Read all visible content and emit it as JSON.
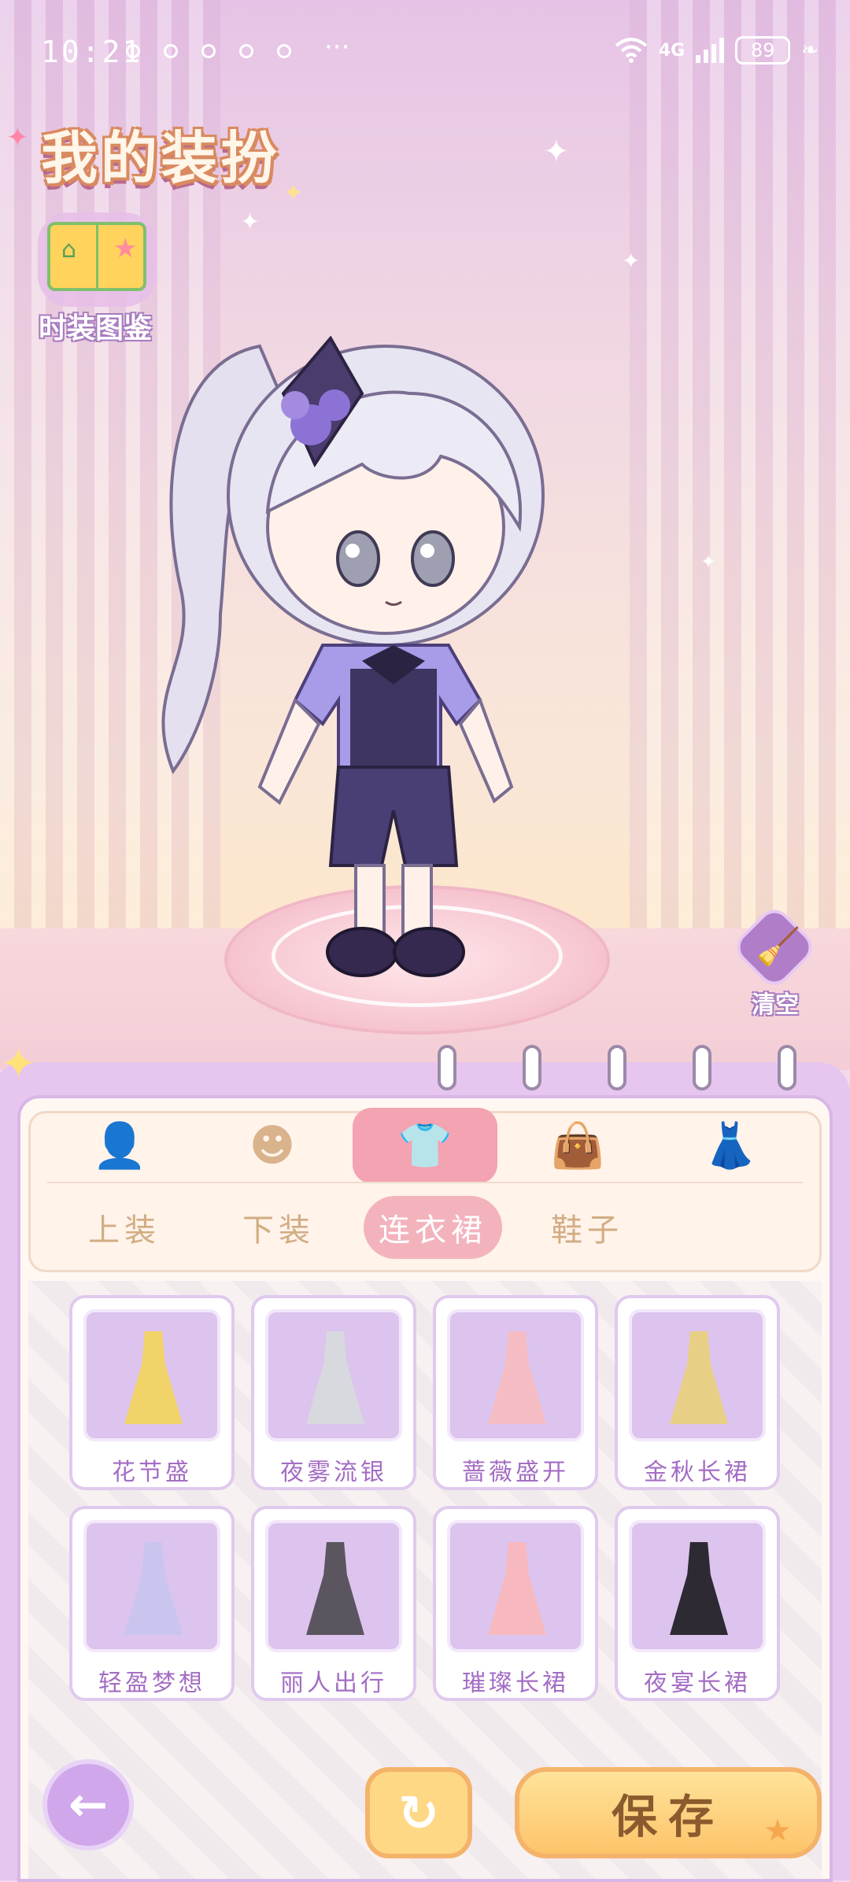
{
  "status_bar": {
    "time": "10:21",
    "more": "···",
    "network": "4G",
    "battery": "89"
  },
  "header": {
    "title": "我的装扮"
  },
  "fashion_book": {
    "label": "时装图鉴"
  },
  "clear_button": {
    "label": "清空"
  },
  "main_tabs": [
    {
      "icon": "hairstyle-icon",
      "active": false
    },
    {
      "icon": "face-icon",
      "active": false
    },
    {
      "icon": "clothing-icon",
      "active": true
    },
    {
      "icon": "bag-icon",
      "active": false
    },
    {
      "icon": "dress-stand-icon",
      "active": false
    }
  ],
  "sub_tabs": [
    {
      "label": "上装",
      "active": false
    },
    {
      "label": "下装",
      "active": false
    },
    {
      "label": "连衣裙",
      "active": true
    },
    {
      "label": "鞋子",
      "active": false
    }
  ],
  "items": [
    {
      "label": "花节盛",
      "color": "#f2d36a"
    },
    {
      "label": "夜雾流银",
      "color": "#d8d8df"
    },
    {
      "label": "蔷薇盛开",
      "color": "#f6bcc4"
    },
    {
      "label": "金秋长裙",
      "color": "#e8cf86"
    },
    {
      "label": "轻盈梦想",
      "color": "#c9c5ee"
    },
    {
      "label": "丽人出行",
      "color": "#5b5560"
    },
    {
      "label": "璀璨长裙",
      "color": "#f7b9bf"
    },
    {
      "label": "夜宴长裙",
      "color": "#2d2a33"
    }
  ],
  "buttons": {
    "back_icon": "back-arrow-icon",
    "refresh_icon": "refresh-icon",
    "save_label": "保存"
  },
  "colors": {
    "accent_pink": "#f3a3b2",
    "panel_purple": "#e6c6ef",
    "save_gold": "#fdc46a"
  }
}
